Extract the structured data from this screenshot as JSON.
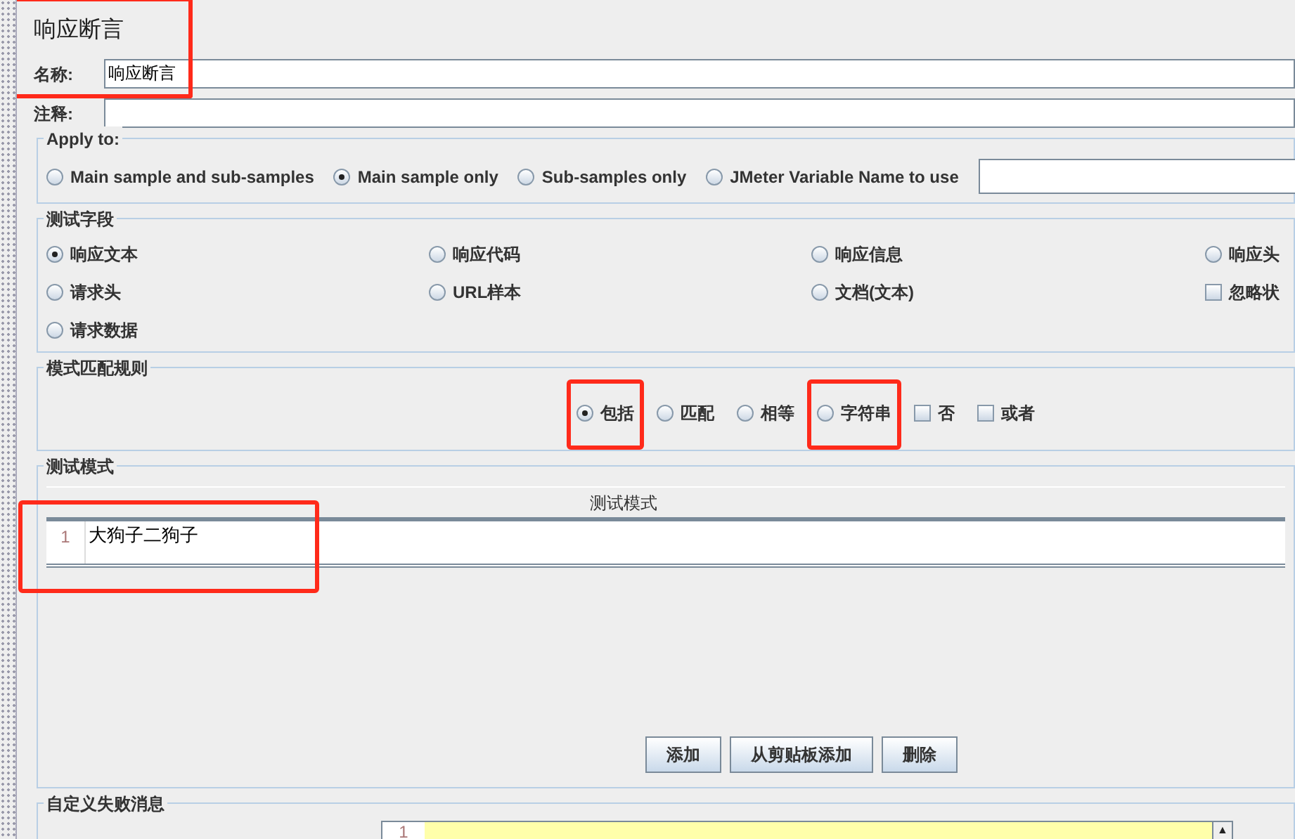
{
  "title": {
    "text": "响应断言",
    "highlighted": true
  },
  "name_field": {
    "label": "名称:",
    "value": "响应断言",
    "highlighted": true
  },
  "comment_field": {
    "label": "注释:"
  },
  "apply_to": {
    "legend": "Apply to:",
    "options": [
      {
        "label": "Main sample and sub-samples",
        "selected": false
      },
      {
        "label": "Main sample only",
        "selected": true
      },
      {
        "label": "Sub-samples only",
        "selected": false
      },
      {
        "label": "JMeter Variable Name to use",
        "selected": false
      }
    ]
  },
  "test_field": {
    "legend": "测试字段",
    "options": [
      {
        "kind": "radio",
        "label": "响应文本",
        "selected": true
      },
      {
        "kind": "radio",
        "label": "响应代码",
        "selected": false
      },
      {
        "kind": "radio",
        "label": "响应信息",
        "selected": false
      },
      {
        "kind": "radio",
        "label": "响应头",
        "selected": false
      },
      {
        "kind": "radio",
        "label": "请求头",
        "selected": false
      },
      {
        "kind": "radio",
        "label": "URL样本",
        "selected": false
      },
      {
        "kind": "radio",
        "label": "文档(文本)",
        "selected": false
      },
      {
        "kind": "checkbox",
        "label": "忽略状",
        "checked": false
      },
      {
        "kind": "radio",
        "label": "请求数据",
        "selected": false
      }
    ]
  },
  "pattern_rules": {
    "legend": "模式匹配规则",
    "options": [
      {
        "kind": "radio",
        "label": "包括",
        "selected": true,
        "highlighted": true
      },
      {
        "kind": "radio",
        "label": "匹配",
        "selected": false,
        "highlighted": false
      },
      {
        "kind": "radio",
        "label": "相等",
        "selected": false,
        "highlighted": false
      },
      {
        "kind": "radio",
        "label": "字符串",
        "selected": false,
        "highlighted": true
      },
      {
        "kind": "checkbox",
        "label": "否",
        "checked": false,
        "highlighted": false
      },
      {
        "kind": "checkbox",
        "label": "或者",
        "checked": false,
        "highlighted": false
      }
    ]
  },
  "test_patterns": {
    "legend": "测试模式",
    "column": "测试模式",
    "rows": [
      {
        "line": "1",
        "text": "大狗子二狗子",
        "highlighted": true
      }
    ],
    "buttons": [
      "添加",
      "从剪贴板添加",
      "删除"
    ]
  },
  "failure_message": {
    "legend": "自定义失败消息",
    "line": "1",
    "scroll_up": "▲"
  }
}
